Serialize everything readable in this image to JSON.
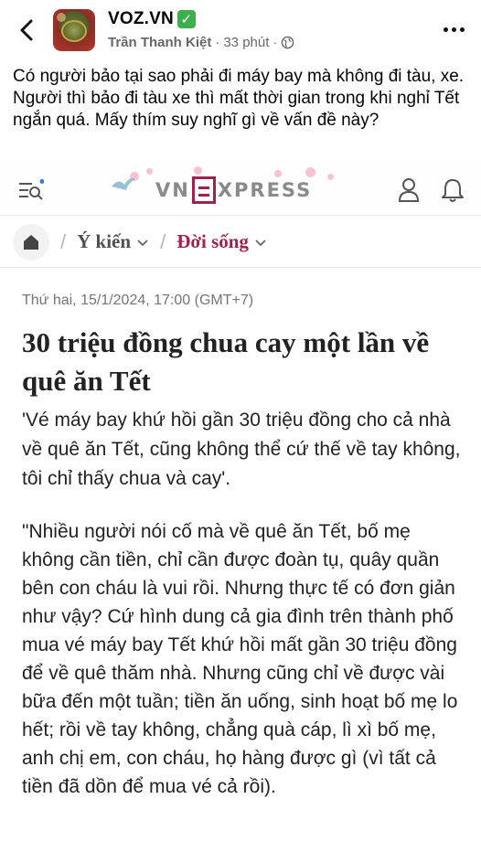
{
  "post": {
    "page_name": "VOZ.VN",
    "verified_mark": "✓",
    "author": "Trần Thanh Kiệt",
    "meta_sep": "·",
    "time_ago": "33 phút",
    "meta_sep2": "·",
    "text": "Có người bảo tại sao phải đi máy bay mà không đi tàu, xe. Người thì bảo đi tàu xe thì mất thời gian trong khi nghỉ Tết ngắn quá. Mấy thím suy nghĩ gì về vấn đề này?"
  },
  "vnexpress": {
    "logo_left": "VN",
    "logo_right": "XPRESS",
    "breadcrumb": {
      "sep": "/",
      "item1": "Ý kiến",
      "item2": "Đời sống"
    },
    "datetime": "Thứ hai, 15/1/2024, 17:00 (GMT+7)",
    "headline": "30 triệu đồng chua cay một lần về quê ăn Tết",
    "lead": "'Vé máy bay khứ hồi gần 30 triệu đồng cho cả nhà về quê ăn Tết, cũng không thể cứ thế về tay không, tôi chỉ thấy chua và cay'.",
    "body": "\"Nhiều người nói cố mà về quê ăn Tết, bố mẹ không cần tiền, chỉ cần được đoàn tụ, quây quần bên con cháu là vui rồi. Nhưng thực tế có đơn giản như vậy? Cứ hình dung cả gia đình trên thành phố mua vé máy bay Tết khứ hồi mất gần 30 triệu đồng để về quê thăm nhà. Nhưng cũng chỉ về được vài bữa đến một tuần; tiền ăn uống, sinh hoạt bố mẹ lo hết; rồi về tay không, chẳng quà cáp, lì xì bố mẹ, anh chị em, con cháu, họ hàng được gì (vì tất cả tiền đã dồn để mua vé cả rồi)."
  },
  "colors": {
    "vne_brand": "#9f224e",
    "verified_green": "#3fae4e",
    "meta_gray": "#65676b"
  },
  "icons": [
    "back-arrow-icon",
    "verified-check-icon",
    "globe-icon",
    "more-dots-icon",
    "menu-search-icon",
    "user-icon",
    "bell-icon",
    "home-icon",
    "chevron-down-icon"
  ]
}
